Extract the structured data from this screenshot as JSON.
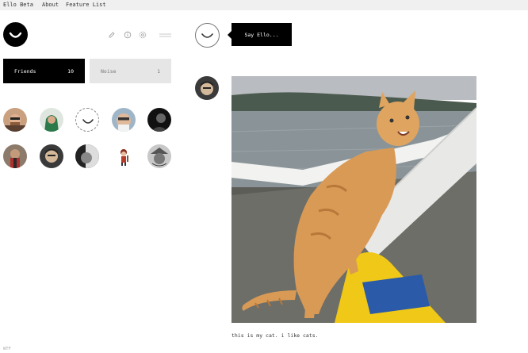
{
  "nav": {
    "brand": "Ello Beta",
    "about": "About",
    "feature_list": "Feature List"
  },
  "profile": {
    "toolbar_icons": [
      "pencil-icon",
      "info-icon",
      "gear-icon",
      "menu-icon"
    ]
  },
  "tabs": {
    "friends": {
      "label": "Friends",
      "count": "10"
    },
    "noise": {
      "label": "Noise",
      "count": "1"
    }
  },
  "friends": [
    {
      "name": "friend-avatar-1",
      "kind": "photo"
    },
    {
      "name": "friend-avatar-2",
      "kind": "photo"
    },
    {
      "name": "friend-avatar-3",
      "kind": "ello-default"
    },
    {
      "name": "friend-avatar-4",
      "kind": "photo"
    },
    {
      "name": "friend-avatar-5",
      "kind": "photo"
    },
    {
      "name": "friend-avatar-6",
      "kind": "photo"
    },
    {
      "name": "friend-avatar-7",
      "kind": "photo"
    },
    {
      "name": "friend-avatar-8",
      "kind": "photo"
    },
    {
      "name": "friend-avatar-9",
      "kind": "illustration"
    },
    {
      "name": "friend-avatar-10",
      "kind": "photo"
    }
  ],
  "composer": {
    "button_label": "Say Ello..."
  },
  "post": {
    "caption": "this is my cat. i like cats."
  },
  "footer": {
    "text": "WTF"
  }
}
